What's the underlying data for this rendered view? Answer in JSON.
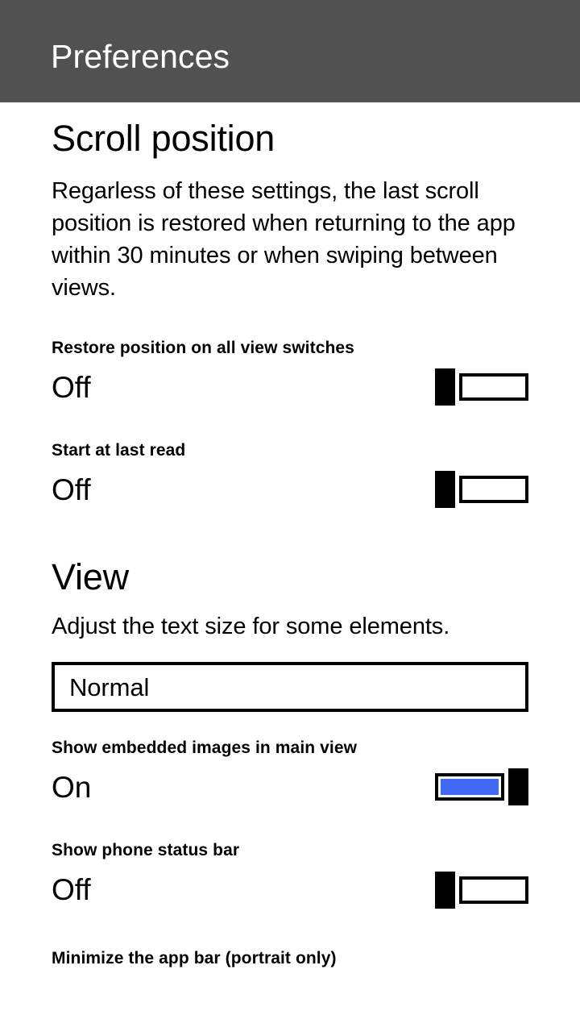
{
  "appbar": {
    "title": "Preferences",
    "background": "#515151",
    "text_color": "#ffffff"
  },
  "theme": {
    "accent": "#4169f5",
    "foreground": "#000000",
    "background": "#ffffff"
  },
  "sections": [
    {
      "heading": "Scroll position",
      "description": "Regarless of these settings, the last scroll position is restored when returning to the app within 30 minutes or when swiping between views.",
      "settings": [
        {
          "label": "Restore position on all view switches",
          "value": "Off",
          "state": "off"
        },
        {
          "label": "Start at last read",
          "value": "Off",
          "state": "off"
        }
      ]
    },
    {
      "heading": "View",
      "description": "Adjust the text size for some elements.",
      "select": {
        "value": "Normal"
      },
      "settings": [
        {
          "label": "Show embedded images in main view",
          "value": "On",
          "state": "on"
        },
        {
          "label": "Show phone status bar",
          "value": "Off",
          "state": "off"
        },
        {
          "label": "Minimize the app bar (portrait only)",
          "value": "",
          "state": "off"
        }
      ]
    }
  ]
}
